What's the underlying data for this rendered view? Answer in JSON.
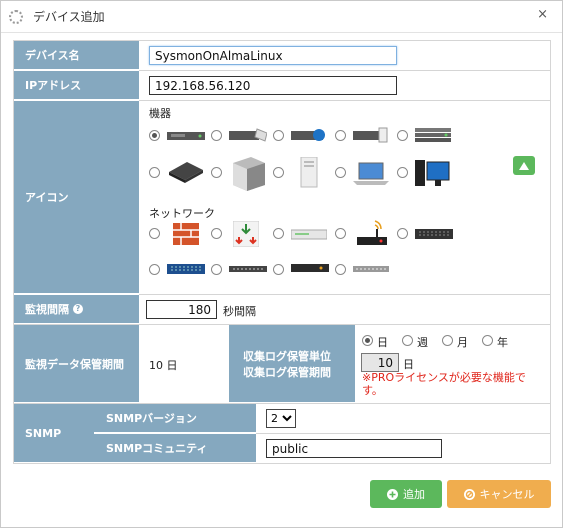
{
  "window": {
    "title": "デバイス追加",
    "close_label": "×"
  },
  "fields": {
    "device_name": {
      "label": "デバイス名",
      "value": "SysmonOnAlmaLinux"
    },
    "ip": {
      "label": "IPアドレス",
      "value": "192.168.56.120"
    },
    "icon": {
      "label": "アイコン",
      "group_devices": "機器",
      "group_network": "ネットワーク",
      "selected_index": 0
    },
    "interval": {
      "label": "監視間隔",
      "value": "180",
      "unit": "秒間隔"
    },
    "retention": {
      "label": "監視データ保管期間",
      "value": "10 日",
      "log_unit_label": "収集ログ保管単位",
      "log_period_label": "収集ログ保管期間",
      "units": [
        "日",
        "週",
        "月",
        "年"
      ],
      "selected_unit": "日",
      "log_value": "10",
      "log_suffix": "日",
      "pro_note": "※PROライセンスが必要な機能で す。"
    },
    "snmp": {
      "label": "SNMP",
      "version_label": "SNMPバージョン",
      "version_value": "2",
      "community_label": "SNMPコミュニティ",
      "community_value": "public"
    }
  },
  "buttons": {
    "add": "追加",
    "cancel": "キャンセル"
  },
  "colors": {
    "label_bg": "#85a8bf",
    "add_btn": "#5cb85c",
    "cancel_btn": "#f0ad4e",
    "pro_note": "#e0251b"
  }
}
